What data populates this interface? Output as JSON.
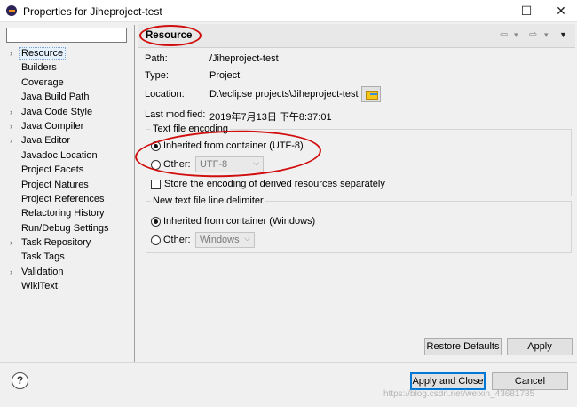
{
  "window": {
    "title": "Properties for Jiheproject-test",
    "minimize": "—",
    "maximize": "☐",
    "close": "✕"
  },
  "filter": {
    "value": ""
  },
  "tree": [
    {
      "label": "Resource",
      "expandable": true,
      "selected": true
    },
    {
      "label": "Builders",
      "expandable": false
    },
    {
      "label": "Coverage",
      "expandable": false
    },
    {
      "label": "Java Build Path",
      "expandable": false
    },
    {
      "label": "Java Code Style",
      "expandable": true
    },
    {
      "label": "Java Compiler",
      "expandable": true
    },
    {
      "label": "Java Editor",
      "expandable": true
    },
    {
      "label": "Javadoc Location",
      "expandable": false
    },
    {
      "label": "Project Facets",
      "expandable": false
    },
    {
      "label": "Project Natures",
      "expandable": false
    },
    {
      "label": "Project References",
      "expandable": false
    },
    {
      "label": "Refactoring History",
      "expandable": false
    },
    {
      "label": "Run/Debug Settings",
      "expandable": false
    },
    {
      "label": "Task Repository",
      "expandable": true
    },
    {
      "label": "Task Tags",
      "expandable": false
    },
    {
      "label": "Validation",
      "expandable": true
    },
    {
      "label": "WikiText",
      "expandable": false
    }
  ],
  "page": {
    "title": "Resource",
    "nav_back": "⇦",
    "nav_back_menu": "▾",
    "nav_forward": "⇨",
    "nav_forward_menu": "▾",
    "view_menu": "▼"
  },
  "info": {
    "path_label": "Path:",
    "path_value": "/Jiheproject-test",
    "type_label": "Type:",
    "type_value": "Project",
    "location_label": "Location:",
    "location_value": "D:\\eclipse projects\\Jiheproject-test",
    "modified_label": "Last modified:",
    "modified_value": "2019年7月13日 下午8:37:01"
  },
  "encoding": {
    "legend": "Text file encoding",
    "inherited_label": "Inherited from container (UTF-8)",
    "inherited_selected": true,
    "other_label": "Other:",
    "other_value": "UTF-8",
    "store_label": "Store the encoding of derived resources separately",
    "store_checked": false
  },
  "delimiter": {
    "legend": "New text file line delimiter",
    "inherited_label": "Inherited from container (Windows)",
    "inherited_selected": true,
    "other_label": "Other:",
    "other_value": "Windows"
  },
  "buttons": {
    "restore_defaults": "Restore Defaults",
    "apply": "Apply",
    "apply_and_close": "Apply and Close",
    "cancel": "Cancel",
    "help": "?"
  },
  "watermark": "https://blog.csdn.net/weixin_43681785"
}
